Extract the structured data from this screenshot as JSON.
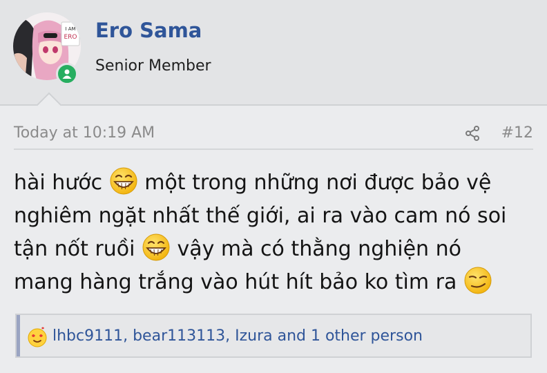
{
  "user": {
    "name": "Ero Sama",
    "title": "Senior Member",
    "avatar_text": "I AM ERO",
    "status": "online"
  },
  "post": {
    "timestamp": "Today at 10:19 AM",
    "number": "#12",
    "lines": [
      {
        "a": "hài hước ",
        "emoji": "grinning-face-icon",
        "b": " một trong những nơi được bảo vệ"
      },
      {
        "a": "nghiêm ngặt nhất thế giới, ai ra vào cam nó soi"
      },
      {
        "a": "tận nốt ruồi ",
        "emoji": "grinning-face-icon",
        "b": " vậy mà có thằng nghiện nó"
      },
      {
        "a": "mang hàng trắng vào hút hít bảo ko tìm ra ",
        "emoji": "smirking-face-icon"
      }
    ]
  },
  "reactions": {
    "icon": "love-reaction-icon",
    "text": "lhbc9111, bear113113, Izura and 1 other person"
  },
  "colors": {
    "accent": "#2f5599",
    "online": "#27ae60",
    "muted": "#8a8a8a"
  }
}
